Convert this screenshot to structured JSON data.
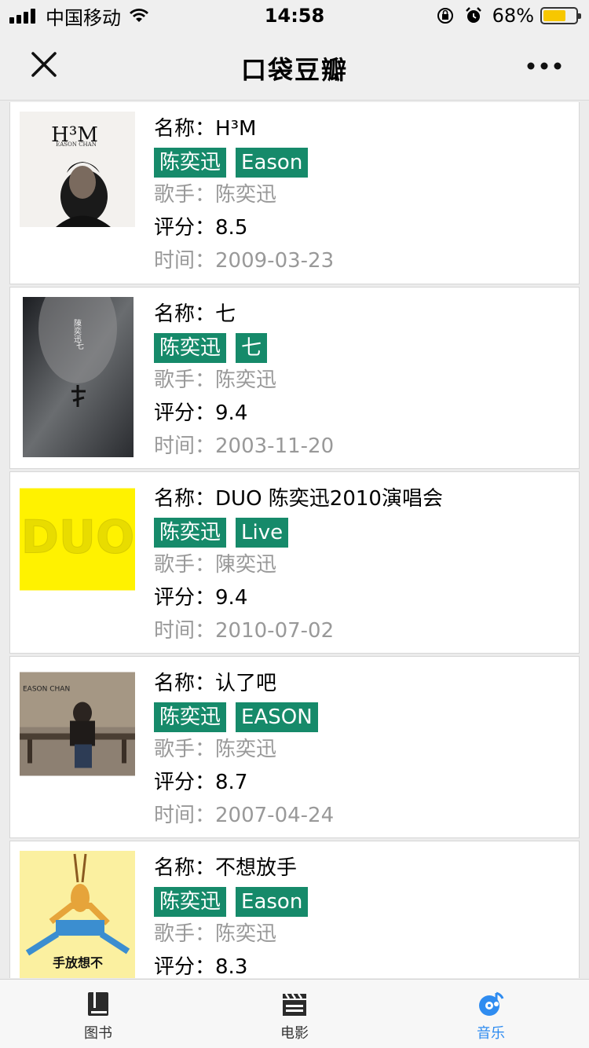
{
  "status": {
    "carrier": "中国移动",
    "time": "14:58",
    "battery": "68%",
    "battery_level": 0.68
  },
  "nav": {
    "title": "口袋豆瓣",
    "close_icon": "close-icon",
    "more_icon": "more-icon"
  },
  "labels": {
    "name": "名称：",
    "singer": "歌手：",
    "rating": "评分：",
    "date": "时间："
  },
  "albums": [
    {
      "name": "H³M",
      "tags": [
        "陈奕迅",
        "Eason"
      ],
      "singer": "陈奕迅",
      "rating": "8.5",
      "date": "2009-03-23",
      "cover_text": [
        "H³M",
        "EASON CHAN"
      ]
    },
    {
      "name": "七",
      "tags": [
        "陈奕迅",
        "七"
      ],
      "singer": "陈奕迅",
      "rating": "9.4",
      "date": "2003-11-20",
      "cover_text": [
        "陳奕迅",
        "七"
      ]
    },
    {
      "name": "DUO 陈奕迅2010演唱会",
      "tags": [
        "陈奕迅",
        "Live"
      ],
      "singer": "陳奕迅",
      "rating": "9.4",
      "date": "2010-07-02",
      "cover_text": [
        "DUO"
      ]
    },
    {
      "name": "认了吧",
      "tags": [
        "陈奕迅",
        "EASON"
      ],
      "singer": "陈奕迅",
      "rating": "8.7",
      "date": "2007-04-24",
      "cover_text": [
        "EASON CHAN"
      ]
    },
    {
      "name": "不想放手",
      "tags": [
        "陈奕迅",
        "Eason"
      ],
      "singer": "陈奕迅",
      "rating": "8.3",
      "date": "",
      "cover_text": [
        "手放想不"
      ]
    }
  ],
  "tabs": [
    {
      "label": "图书",
      "icon": "book-icon",
      "active": false
    },
    {
      "label": "电影",
      "icon": "clapperboard-icon",
      "active": false
    },
    {
      "label": "音乐",
      "icon": "music-disc-icon",
      "active": true
    }
  ],
  "colors": {
    "tag_bg": "#168a6a",
    "active_tab": "#2f8cf0",
    "battery": "#f7c700"
  }
}
